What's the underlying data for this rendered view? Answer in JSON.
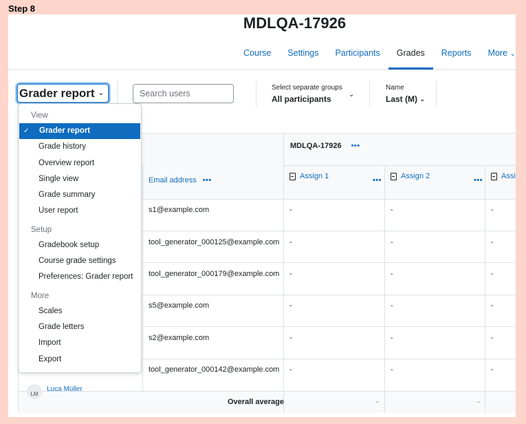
{
  "step_label": "Step 8",
  "course_title": "MDLQA-17926",
  "nav": [
    {
      "label": "Course",
      "active": false
    },
    {
      "label": "Settings",
      "active": false
    },
    {
      "label": "Participants",
      "active": false
    },
    {
      "label": "Grades",
      "active": true
    },
    {
      "label": "Reports",
      "active": false
    },
    {
      "label": "More",
      "active": false
    }
  ],
  "toolbar": {
    "report_select": "Grader report",
    "search_placeholder": "Search users",
    "group_label": "Select separate groups",
    "group_value": "All participants",
    "name_label": "Name",
    "name_value": "Last (M)"
  },
  "dropdown": {
    "sections": [
      {
        "header": "View",
        "items": [
          {
            "label": "Grader report",
            "active": true
          },
          {
            "label": "Grade history",
            "active": false
          },
          {
            "label": "Overview report",
            "active": false
          },
          {
            "label": "Single view",
            "active": false
          },
          {
            "label": "Grade summary",
            "active": false
          },
          {
            "label": "User report",
            "active": false
          }
        ]
      },
      {
        "header": "Setup",
        "items": [
          {
            "label": "Gradebook setup",
            "active": false
          },
          {
            "label": "Course grade settings",
            "active": false
          },
          {
            "label": "Preferences: Grader report",
            "active": false
          }
        ]
      },
      {
        "header": "More",
        "items": [
          {
            "label": "Scales",
            "active": false
          },
          {
            "label": "Grade letters",
            "active": false
          },
          {
            "label": "Import",
            "active": false
          },
          {
            "label": "Export",
            "active": false
          }
        ]
      }
    ]
  },
  "table": {
    "course_header": "MDLQA-17926",
    "email_header": "Email address",
    "assignments": [
      "Assign 1",
      "Assign 2",
      "Assi"
    ],
    "rows": [
      {
        "email": "s1@example.com",
        "grades": [
          "-",
          "-",
          "-"
        ]
      },
      {
        "email": "tool_generator_000125@example.com",
        "grades": [
          "-",
          "-",
          "-"
        ]
      },
      {
        "email": "tool_generator_000179@example.com",
        "grades": [
          "-",
          "-",
          "-"
        ]
      },
      {
        "email": "s5@example.com",
        "grades": [
          "-",
          "-",
          "-"
        ]
      },
      {
        "email": "s2@example.com",
        "grades": [
          "-",
          "-",
          "-"
        ]
      },
      {
        "email": "tool_generator_000142@example.com",
        "grades": [
          "-",
          "-",
          "-"
        ]
      }
    ],
    "partial_user": {
      "initials": "LM",
      "name": "Luca Müller"
    },
    "overall_label": "Overall average",
    "overall_values": [
      "-",
      "-"
    ]
  }
}
